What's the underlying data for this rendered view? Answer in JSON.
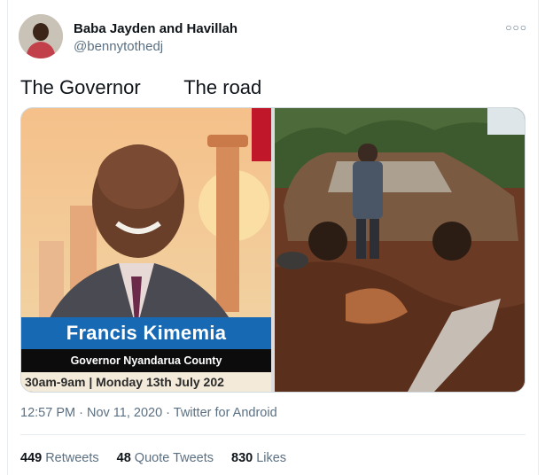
{
  "author": {
    "display_name": "Baba Jayden and Havillah",
    "handle": "@bennytothedj"
  },
  "more_icon": "more-options-icon",
  "tweet": {
    "text": "The Governor        The road"
  },
  "media": {
    "left_photo": {
      "name": "Francis Kimemia",
      "title": "Governor Nyandarua County",
      "schedule": "30am-9am | Monday 13th July 202"
    },
    "right_photo": {
      "subject": "muddy-road-car-photo"
    }
  },
  "meta": {
    "time": "12:57 PM",
    "sep1": " · ",
    "date": "Nov 11, 2020",
    "sep2": " · ",
    "client": "Twitter for Android"
  },
  "stats": [
    {
      "count": "449",
      "label": "Retweets"
    },
    {
      "count": "48",
      "label": "Quote Tweets"
    },
    {
      "count": "830",
      "label": "Likes"
    }
  ],
  "colors": {
    "banner_blue": "#1769b3",
    "muted_text": "#5b7083",
    "mud": "#6b3a25"
  }
}
